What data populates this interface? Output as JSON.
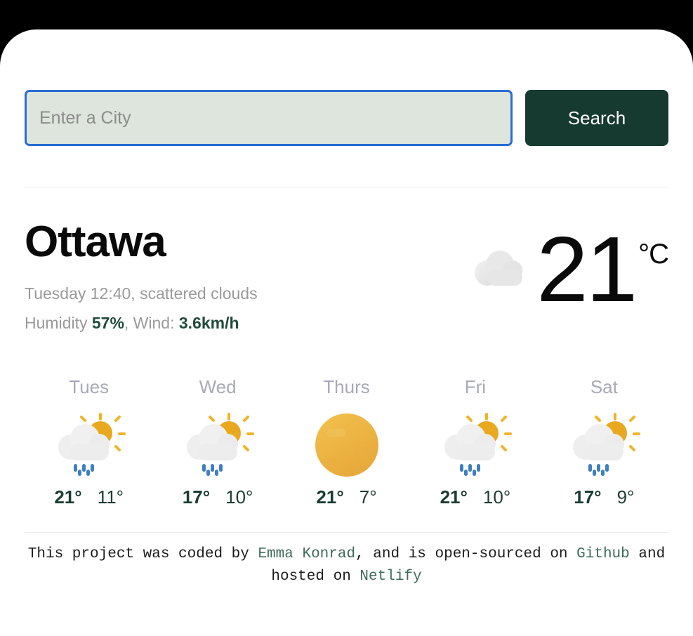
{
  "search": {
    "placeholder": "Enter a City",
    "value": "",
    "button_label": "Search"
  },
  "current": {
    "city": "Ottawa",
    "meta_time_conditions": "Tuesday 12:40, scattered clouds",
    "humidity_prefix": "Humidity ",
    "humidity_value": "57%",
    "wind_prefix": ", Wind: ",
    "wind_value": "3.6km/h",
    "temperature": "21",
    "unit": "°C",
    "icon": "cloud-icon"
  },
  "forecast": [
    {
      "day": "Tues",
      "icon": "sun-cloud-rain-icon",
      "high": "21°",
      "low": "11°"
    },
    {
      "day": "Wed",
      "icon": "sun-cloud-rain-icon",
      "high": "17°",
      "low": "10°"
    },
    {
      "day": "Thurs",
      "icon": "sun-icon",
      "high": "21°",
      "low": "7°"
    },
    {
      "day": "Fri",
      "icon": "sun-cloud-rain-icon",
      "high": "21°",
      "low": "10°"
    },
    {
      "day": "Sat",
      "icon": "sun-cloud-rain-icon",
      "high": "17°",
      "low": "9°"
    }
  ],
  "footer": {
    "part1": "This project was coded by ",
    "author": "Emma Konrad",
    "part2": ", and is open-sourced on ",
    "github": "Github",
    "part3": " and hosted on ",
    "netlify": "Netlify"
  },
  "colors": {
    "accent_green": "#173a30",
    "focus_blue": "#2b6cd4",
    "input_bg": "#dde5dc",
    "link_green": "#3d6b5a",
    "temp_green": "#1b3d34"
  }
}
